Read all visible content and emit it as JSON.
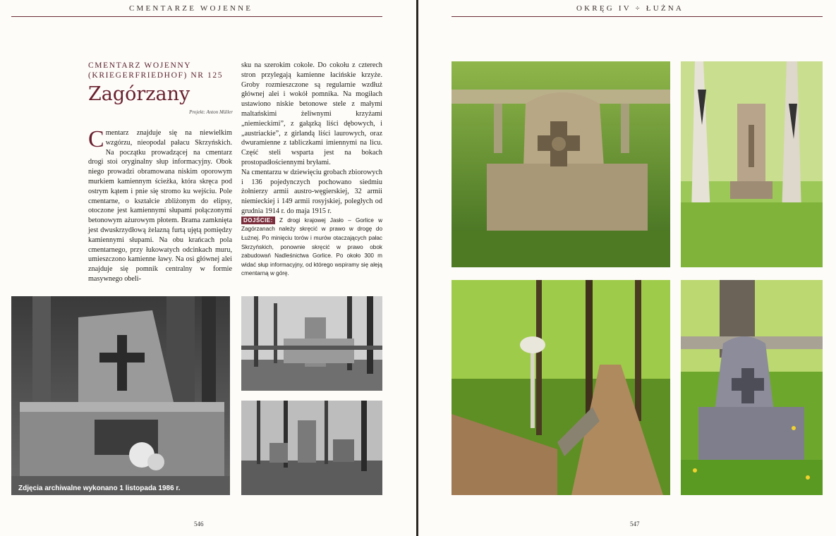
{
  "left_page": {
    "running_head": "CMENTARZE WOJENNE",
    "kicker_line1": "CMENTARZ WOJENNY",
    "kicker_line2": "(KRIEGERFRIEDHOF) NR 125",
    "title": "Zagórzany",
    "credit": "Projekt: Anton Müller",
    "dropcap": "C",
    "col_a_text": "mentarz znajduje się na niewielkim wzgórzu, nieopodal pałacu Skrzyńskich. Na początku prowadzącej na cmentarz drogi stoi oryginalny słup informacyjny. Obok niego prowadzi obramowana niskim oporowym murkiem kamiennym ścieżka, która skręca pod ostrym kątem i pnie się stromo ku wejściu. Pole cmentarne, o kształcie zbliżonym do elipsy, otoczone jest kamiennymi słupami połączonymi betonowym ażurowym płotem. Brama zamknięta jest dwuskrzydłową żelazną furtą ujętą pomiędzy kamiennymi słupami. Na obu krańcach pola cmentarnego, przy łukowatych odcinkach muru, umieszczono kamienne ławy. Na osi głównej alei znajduje się pomnik centralny w formie masywnego obeli-",
    "col_b_text_1": "sku na szerokim cokole. Do cokołu z czterech stron przylegają kamienne łacińskie krzyże. Groby rozmieszczone są regularnie wzdłuż głównej alei i wokół pomnika. Na mogiłach ustawiono niskie betonowe stele z małymi maltańskimi żeliwnymi krzyżami „niemieckimi”, z gałązką liści dębowych, i „austriackie”, z girlandą liści laurowych, oraz dwuramienne z tabliczkami imiennymi na licu. Część steli wsparta jest na bokach prostopadłościennymi bryłami.",
    "col_b_text_2": "Na cmentarzu w dziewięciu grobach zbiorowych i 136 pojedynczych pochowano siedmiu żołnierzy armii austro-węgierskiej, 32 armii niemieckiej i 149 armii rosyjskiej, poległych od grudnia 1914 r. do maja 1915 r.",
    "directions_label": "DOJŚCIE:",
    "directions_text": "Z drogi krajowej Jasło – Gorlice w Zagórzanach należy skręcić w prawo w drogę do Łużnej. Po minięciu torów i murów otaczających pałac Skrzyńskich, ponownie skręcić w prawo obok zabudowań Nadleśnictwa Gorlice. Po około 300 m widać słup informacyjny, od którego wspiramy się aleją cmentarną w górę.",
    "photo_caption": "Zdjęcia archiwalne wykonano 1 listopada 1986 r.",
    "folio": "546"
  },
  "right_page": {
    "running_head": "OKRĘG IV ÷ ŁUŻNA",
    "folio": "547"
  },
  "colors": {
    "accent": "#6a1f2d",
    "directions_badge": "#7b2e3c",
    "gutter": "#2a2521"
  },
  "photos": {
    "left_main": "archival-bw-grave-with-cross",
    "left_top_right": "archival-bw-monument",
    "left_bottom_right": "archival-bw-graves-row",
    "right_top_left": "color-grave-stele-1915",
    "right_top_right": "color-central-monument",
    "right_bottom_left": "color-path-with-signpost",
    "right_bottom_right": "color-grave-stele-in-grass"
  }
}
